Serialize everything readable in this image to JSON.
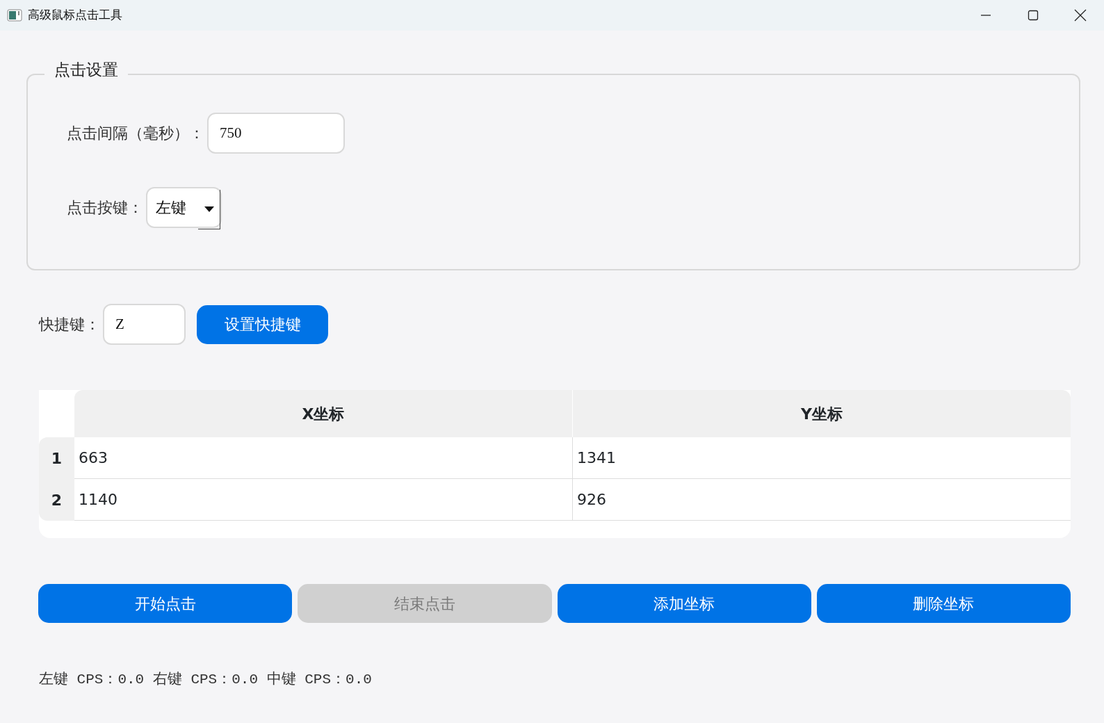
{
  "window": {
    "title": "高级鼠标点击工具"
  },
  "click_settings": {
    "title": "点击设置",
    "interval": {
      "label": "点击间隔（毫秒）：",
      "value": "750"
    },
    "mouse_button": {
      "label": "点击按键：",
      "value": "左键"
    }
  },
  "hotkey": {
    "label": "快捷键：",
    "value": "Z",
    "button": "设置快捷键"
  },
  "table": {
    "columns": [
      "X坐标",
      "Y坐标"
    ],
    "rows": [
      {
        "header": "1",
        "cells": [
          "663",
          "1341"
        ]
      },
      {
        "header": "2",
        "cells": [
          "1140",
          "926"
        ]
      }
    ]
  },
  "actions": [
    {
      "label": "开始点击",
      "disabled": false
    },
    {
      "label": "结束点击",
      "disabled": true
    },
    {
      "label": "添加坐标",
      "disabled": false
    },
    {
      "label": "删除坐标",
      "disabled": false
    }
  ],
  "status_bar": "左键 CPS：0.0 右键 CPS：0.0 中键 CPS：0.0"
}
